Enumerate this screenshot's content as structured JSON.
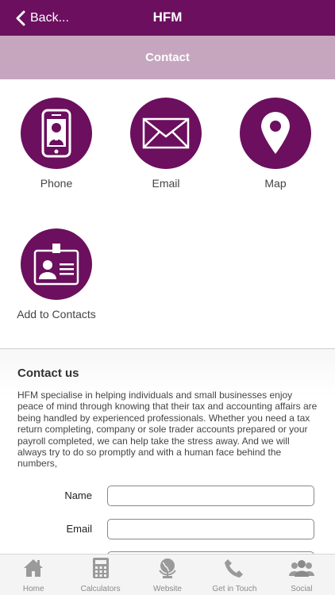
{
  "navbar": {
    "back_label": "Back...",
    "title": "HFM"
  },
  "subheader": {
    "title": "Contact"
  },
  "actions": [
    {
      "label": "Phone",
      "icon": "phone-icon"
    },
    {
      "label": "Email",
      "icon": "envelope-icon"
    },
    {
      "label": "Map",
      "icon": "map-pin-icon"
    },
    {
      "label": "Add to Contacts",
      "icon": "contact-card-icon"
    }
  ],
  "contact": {
    "title": "Contact us",
    "description": "HFM specialise in helping individuals and small businesses enjoy peace of mind through knowing that their tax and accounting affairs are being handled by experienced professionals. Whether you need a tax return completing, company or sole trader accounts prepared or your payroll completed, we can help take the stress away. And we will always try to do so promptly and with a human face behind the numbers,",
    "fields": [
      {
        "label": "Name",
        "value": ""
      },
      {
        "label": "Email",
        "value": ""
      }
    ]
  },
  "tabbar": [
    {
      "label": "Home",
      "icon": "home-icon"
    },
    {
      "label": "Calculators",
      "icon": "calculator-icon"
    },
    {
      "label": "Website",
      "icon": "globe-icon"
    },
    {
      "label": "Get in Touch",
      "icon": "telephone-handset-icon"
    },
    {
      "label": "Social",
      "icon": "people-icon"
    }
  ],
  "colors": {
    "brand": "#6b0f5e",
    "subheader": "#c6a6bf",
    "tab_icon": "#9a9a9a"
  }
}
